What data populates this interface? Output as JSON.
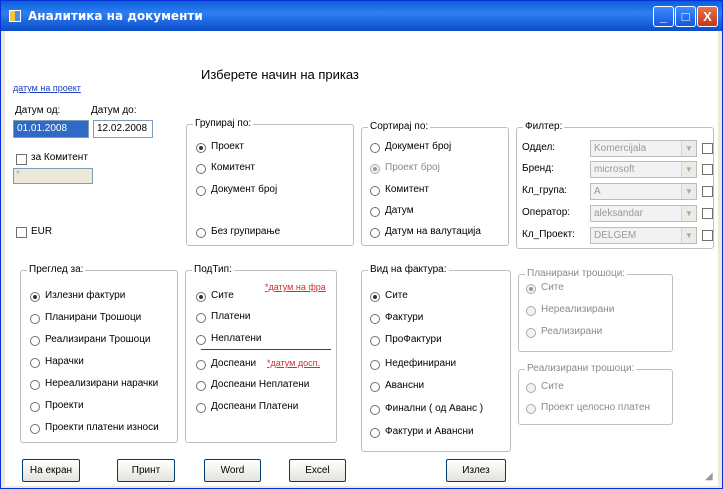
{
  "window": {
    "title": "Аналитика на документи",
    "min": "_",
    "max": "□",
    "close": "X"
  },
  "heading": "Изберете начин на приказ",
  "top": {
    "project_date_link": "датум на проект",
    "date_from_label": "Датум од:",
    "date_to_label": "Датум до:",
    "date_from": "01.01.2008",
    "date_to": "12.02.2008",
    "client_check_label": "за Комитент",
    "client_field": "*",
    "eur_label": "EUR"
  },
  "group_by": {
    "title": "Групирај по:",
    "options": [
      "Проект",
      "Комитент",
      "Документ број",
      "Без групирање"
    ],
    "selected": 0
  },
  "sort_by": {
    "title": "Сортирај по:",
    "options": [
      "Документ број",
      "Проект број",
      "Комитент",
      "Датум",
      "Датум на валутација"
    ],
    "selected": 1
  },
  "filter": {
    "title": "Филтер:",
    "rows": [
      {
        "label": "Оддел:",
        "value": "Komercijala"
      },
      {
        "label": "Бренд:",
        "value": "microsoft"
      },
      {
        "label": "Кл_група:",
        "value": "A"
      },
      {
        "label": "Оператор:",
        "value": "aleksandar"
      },
      {
        "label": "Кл_Проект:",
        "value": "DELGEM"
      }
    ]
  },
  "overview": {
    "title": "Преглед за:",
    "options": [
      "Излезни фактури",
      "Планирани Трошоци",
      "Реализирани Трошоци",
      "Нарачки",
      "Нереализирани нарачки",
      "Проекти",
      "Проекти платени износи"
    ],
    "selected": 0
  },
  "subtype": {
    "title": "ПодТип:",
    "invoice_date_link": "*датум на фра",
    "due_date_link": "*датум досп.",
    "options": [
      "Сите",
      "Платени",
      "Неплатени",
      "Доспеани",
      "Доспеани Неплатени",
      "Доспеани Платени"
    ],
    "selected": 0
  },
  "invoice_type": {
    "title": "Вид на фактура:",
    "options": [
      "Сите",
      "Фактури",
      "ПроФактури",
      "Недефинирани",
      "Авансни",
      "Финални ( од Аванс )",
      "Фактури и Авансни"
    ],
    "selected": 0
  },
  "planned": {
    "title": "Планирани трошоци:",
    "options": [
      "Сите",
      "Нереализирани",
      "Реализирани"
    ],
    "selected": 0
  },
  "realized": {
    "title": "Реализирани трошоци:",
    "options": [
      "Сите",
      "Проект целосно платен"
    ],
    "selected": -1
  },
  "buttons": {
    "screen": "На екран",
    "print": "Принт",
    "word": "Word",
    "excel": "Excel",
    "exit": "Излез"
  }
}
